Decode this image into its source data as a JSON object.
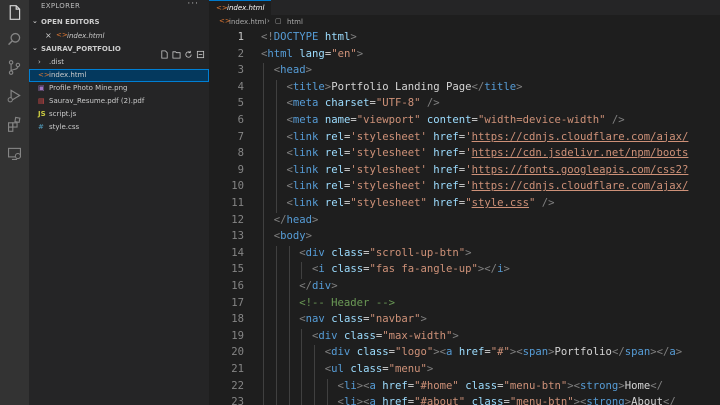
{
  "sidebar": {
    "title": "EXPLORER",
    "more": "···",
    "open_editors_label": "OPEN EDITORS",
    "open_editor_file": "index.html",
    "project_label": "SAURAV_PORTFOLIO",
    "files": [
      {
        "name": ".dist",
        "kind": "folder"
      },
      {
        "name": "index.html",
        "kind": "html"
      },
      {
        "name": "Profile Photo Mine.png",
        "kind": "image"
      },
      {
        "name": "Saurav_Resume.pdf (2).pdf",
        "kind": "pdf"
      },
      {
        "name": "script.js",
        "kind": "js"
      },
      {
        "name": "style.css",
        "kind": "css"
      }
    ]
  },
  "editor": {
    "tab_label": "index.html",
    "breadcrumb": [
      "index.html",
      "html"
    ],
    "current_line": 1,
    "lines": [
      [
        [
          "pu",
          "<!"
        ],
        [
          "tg",
          "DOCTYPE"
        ],
        [
          "tx",
          " "
        ],
        [
          "at",
          "html"
        ],
        [
          "pu",
          ">"
        ]
      ],
      [
        [
          "pu",
          "<"
        ],
        [
          "tg",
          "html"
        ],
        [
          "tx",
          " "
        ],
        [
          "at",
          "lang"
        ],
        [
          "tx",
          "="
        ],
        [
          "sv",
          "\"en\""
        ],
        [
          "pu",
          ">"
        ]
      ],
      [
        [
          "tx",
          "  "
        ],
        [
          "pu",
          "<"
        ],
        [
          "tg",
          "head"
        ],
        [
          "pu",
          ">"
        ]
      ],
      [
        [
          "tx",
          "    "
        ],
        [
          "pu",
          "<"
        ],
        [
          "tg",
          "title"
        ],
        [
          "pu",
          ">"
        ],
        [
          "tx",
          "Portfolio Landing Page"
        ],
        [
          "pu",
          "</"
        ],
        [
          "tg",
          "title"
        ],
        [
          "pu",
          ">"
        ]
      ],
      [
        [
          "tx",
          "    "
        ],
        [
          "pu",
          "<"
        ],
        [
          "tg",
          "meta"
        ],
        [
          "tx",
          " "
        ],
        [
          "at",
          "charset"
        ],
        [
          "tx",
          "="
        ],
        [
          "sv",
          "\"UTF-8\""
        ],
        [
          "tx",
          " "
        ],
        [
          "pu",
          "/>"
        ]
      ],
      [
        [
          "tx",
          "    "
        ],
        [
          "pu",
          "<"
        ],
        [
          "tg",
          "meta"
        ],
        [
          "tx",
          " "
        ],
        [
          "at",
          "name"
        ],
        [
          "tx",
          "="
        ],
        [
          "sv",
          "\"viewport\""
        ],
        [
          "tx",
          " "
        ],
        [
          "at",
          "content"
        ],
        [
          "tx",
          "="
        ],
        [
          "sv",
          "\"width=device-width\""
        ],
        [
          "tx",
          " "
        ],
        [
          "pu",
          "/>"
        ]
      ],
      [
        [
          "tx",
          "    "
        ],
        [
          "pu",
          "<"
        ],
        [
          "tg",
          "link"
        ],
        [
          "tx",
          " "
        ],
        [
          "at",
          "rel"
        ],
        [
          "tx",
          "="
        ],
        [
          "sv",
          "'stylesheet'"
        ],
        [
          "tx",
          " "
        ],
        [
          "at",
          "href"
        ],
        [
          "tx",
          "="
        ],
        [
          "sv",
          "'"
        ],
        [
          "svu",
          "https://cdnjs.cloudflare.com/ajax/"
        ]
      ],
      [
        [
          "tx",
          "    "
        ],
        [
          "pu",
          "<"
        ],
        [
          "tg",
          "link"
        ],
        [
          "tx",
          " "
        ],
        [
          "at",
          "rel"
        ],
        [
          "tx",
          "="
        ],
        [
          "sv",
          "'stylesheet'"
        ],
        [
          "tx",
          " "
        ],
        [
          "at",
          "href"
        ],
        [
          "tx",
          "="
        ],
        [
          "sv",
          "'"
        ],
        [
          "svu",
          "https://cdn.jsdelivr.net/npm/boots"
        ]
      ],
      [
        [
          "tx",
          "    "
        ],
        [
          "pu",
          "<"
        ],
        [
          "tg",
          "link"
        ],
        [
          "tx",
          " "
        ],
        [
          "at",
          "rel"
        ],
        [
          "tx",
          "="
        ],
        [
          "sv",
          "'stylesheet'"
        ],
        [
          "tx",
          " "
        ],
        [
          "at",
          "href"
        ],
        [
          "tx",
          "="
        ],
        [
          "sv",
          "'"
        ],
        [
          "svu",
          "https://fonts.googleapis.com/css2?"
        ]
      ],
      [
        [
          "tx",
          "    "
        ],
        [
          "pu",
          "<"
        ],
        [
          "tg",
          "link"
        ],
        [
          "tx",
          " "
        ],
        [
          "at",
          "rel"
        ],
        [
          "tx",
          "="
        ],
        [
          "sv",
          "'stylesheet'"
        ],
        [
          "tx",
          " "
        ],
        [
          "at",
          "href"
        ],
        [
          "tx",
          "="
        ],
        [
          "sv",
          "'"
        ],
        [
          "svu",
          "https://cdnjs.cloudflare.com/ajax/"
        ]
      ],
      [
        [
          "tx",
          "    "
        ],
        [
          "pu",
          "<"
        ],
        [
          "tg",
          "link"
        ],
        [
          "tx",
          " "
        ],
        [
          "at",
          "rel"
        ],
        [
          "tx",
          "="
        ],
        [
          "sv",
          "\"stylesheet\""
        ],
        [
          "tx",
          " "
        ],
        [
          "at",
          "href"
        ],
        [
          "tx",
          "="
        ],
        [
          "sv",
          "\""
        ],
        [
          "svu",
          "style.css"
        ],
        [
          "sv",
          "\""
        ],
        [
          "tx",
          " "
        ],
        [
          "pu",
          "/>"
        ]
      ],
      [
        [
          "tx",
          "  "
        ],
        [
          "pu",
          "</"
        ],
        [
          "tg",
          "head"
        ],
        [
          "pu",
          ">"
        ]
      ],
      [
        [
          "tx",
          "  "
        ],
        [
          "pu",
          "<"
        ],
        [
          "tg",
          "body"
        ],
        [
          "pu",
          ">"
        ]
      ],
      [
        [
          "tx",
          "      "
        ],
        [
          "pu",
          "<"
        ],
        [
          "tg",
          "div"
        ],
        [
          "tx",
          " "
        ],
        [
          "at",
          "class"
        ],
        [
          "tx",
          "="
        ],
        [
          "sv",
          "\"scroll-up-btn\""
        ],
        [
          "pu",
          ">"
        ]
      ],
      [
        [
          "tx",
          "        "
        ],
        [
          "pu",
          "<"
        ],
        [
          "tg",
          "i"
        ],
        [
          "tx",
          " "
        ],
        [
          "at",
          "class"
        ],
        [
          "tx",
          "="
        ],
        [
          "sv",
          "\"fas fa-angle-up\""
        ],
        [
          "pu",
          "></"
        ],
        [
          "tg",
          "i"
        ],
        [
          "pu",
          ">"
        ]
      ],
      [
        [
          "tx",
          "      "
        ],
        [
          "pu",
          "</"
        ],
        [
          "tg",
          "div"
        ],
        [
          "pu",
          ">"
        ]
      ],
      [
        [
          "tx",
          "      "
        ],
        [
          "cm",
          "<!-- Header -->"
        ]
      ],
      [
        [
          "tx",
          "      "
        ],
        [
          "pu",
          "<"
        ],
        [
          "tg",
          "nav"
        ],
        [
          "tx",
          " "
        ],
        [
          "at",
          "class"
        ],
        [
          "tx",
          "="
        ],
        [
          "sv",
          "\"navbar\""
        ],
        [
          "pu",
          ">"
        ]
      ],
      [
        [
          "tx",
          "        "
        ],
        [
          "pu",
          "<"
        ],
        [
          "tg",
          "div"
        ],
        [
          "tx",
          " "
        ],
        [
          "at",
          "class"
        ],
        [
          "tx",
          "="
        ],
        [
          "sv",
          "\"max-width\""
        ],
        [
          "pu",
          ">"
        ]
      ],
      [
        [
          "tx",
          "          "
        ],
        [
          "pu",
          "<"
        ],
        [
          "tg",
          "div"
        ],
        [
          "tx",
          " "
        ],
        [
          "at",
          "class"
        ],
        [
          "tx",
          "="
        ],
        [
          "sv",
          "\"logo\""
        ],
        [
          "pu",
          "><"
        ],
        [
          "tg",
          "a"
        ],
        [
          "tx",
          " "
        ],
        [
          "at",
          "href"
        ],
        [
          "tx",
          "="
        ],
        [
          "sv",
          "\"#\""
        ],
        [
          "pu",
          "><"
        ],
        [
          "tg",
          "span"
        ],
        [
          "pu",
          ">"
        ],
        [
          "tx",
          "Portfolio"
        ],
        [
          "pu",
          "</"
        ],
        [
          "tg",
          "span"
        ],
        [
          "pu",
          "></"
        ],
        [
          "tg",
          "a"
        ],
        [
          "pu",
          ">"
        ]
      ],
      [
        [
          "tx",
          "          "
        ],
        [
          "pu",
          "<"
        ],
        [
          "tg",
          "ul"
        ],
        [
          "tx",
          " "
        ],
        [
          "at",
          "class"
        ],
        [
          "tx",
          "="
        ],
        [
          "sv",
          "\"menu\""
        ],
        [
          "pu",
          ">"
        ]
      ],
      [
        [
          "tx",
          "            "
        ],
        [
          "pu",
          "<"
        ],
        [
          "tg",
          "li"
        ],
        [
          "pu",
          "><"
        ],
        [
          "tg",
          "a"
        ],
        [
          "tx",
          " "
        ],
        [
          "at",
          "href"
        ],
        [
          "tx",
          "="
        ],
        [
          "sv",
          "\"#home\""
        ],
        [
          "tx",
          " "
        ],
        [
          "at",
          "class"
        ],
        [
          "tx",
          "="
        ],
        [
          "sv",
          "\"menu-btn\""
        ],
        [
          "pu",
          "><"
        ],
        [
          "tg",
          "strong"
        ],
        [
          "pu",
          ">"
        ],
        [
          "tx",
          "Home"
        ],
        [
          "pu",
          "</"
        ]
      ],
      [
        [
          "tx",
          "            "
        ],
        [
          "pu",
          "<"
        ],
        [
          "tg",
          "li"
        ],
        [
          "pu",
          "><"
        ],
        [
          "tg",
          "a"
        ],
        [
          "tx",
          " "
        ],
        [
          "at",
          "href"
        ],
        [
          "tx",
          "="
        ],
        [
          "sv",
          "\"#about\""
        ],
        [
          "tx",
          " "
        ],
        [
          "at",
          "class"
        ],
        [
          "tx",
          "="
        ],
        [
          "sv",
          "\"menu-btn\""
        ],
        [
          "pu",
          "><"
        ],
        [
          "tg",
          "strong"
        ],
        [
          "pu",
          ">"
        ],
        [
          "tx",
          "About"
        ],
        [
          "pu",
          "</"
        ]
      ]
    ]
  }
}
